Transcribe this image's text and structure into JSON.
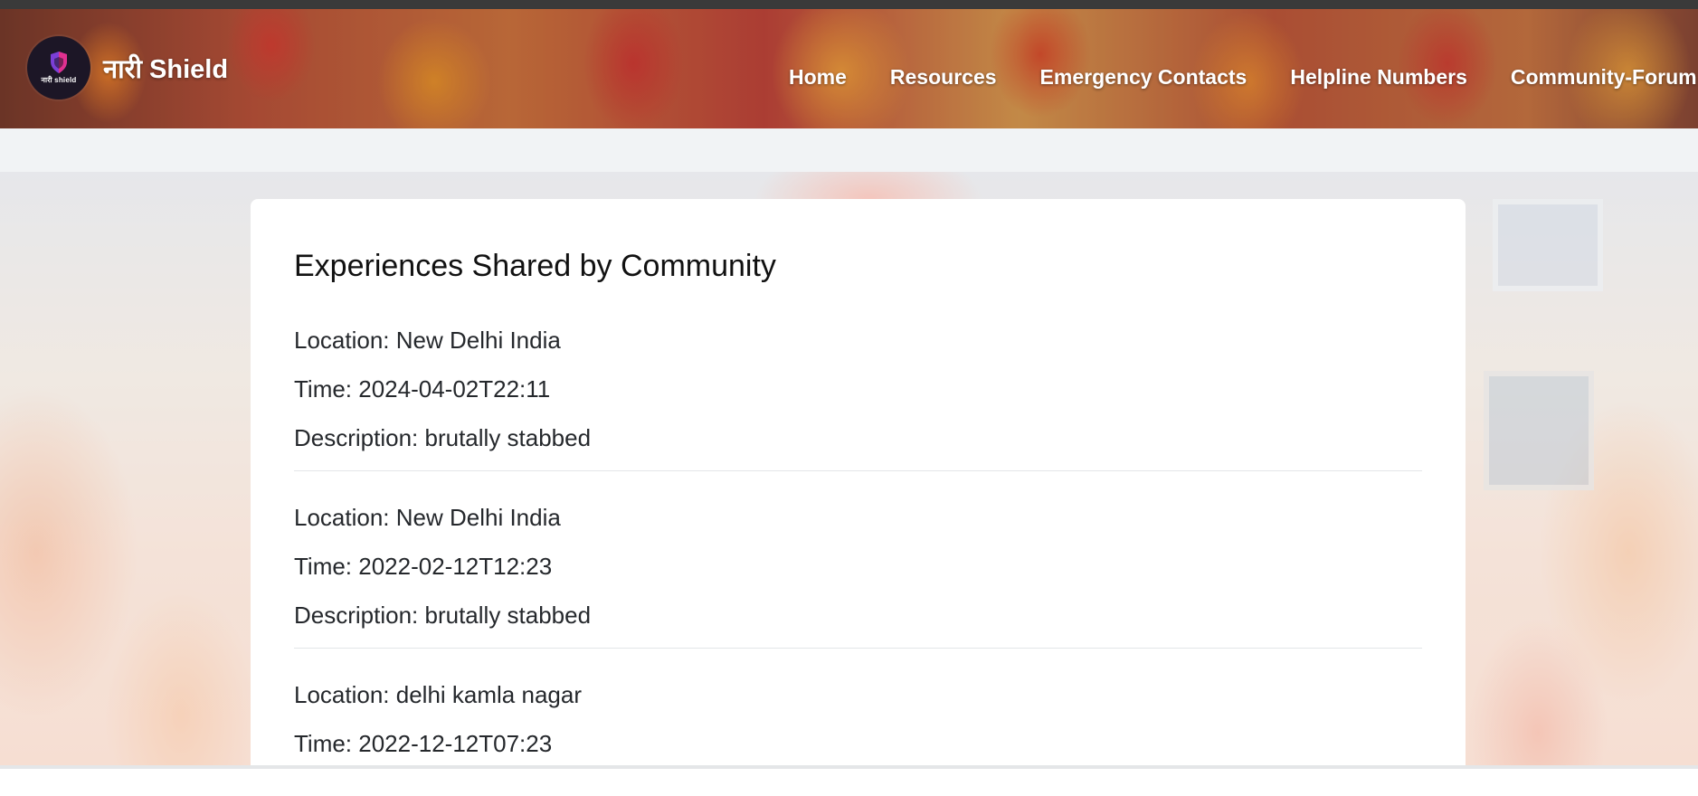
{
  "brand": {
    "name": "नारी Shield",
    "logo_text": "नारी shield",
    "logo_icon": "shield-icon"
  },
  "nav": {
    "links": [
      {
        "label": "Home"
      },
      {
        "label": "Resources"
      },
      {
        "label": "Emergency Contacts"
      },
      {
        "label": "Helpline Numbers"
      },
      {
        "label": "Community-Forum"
      }
    ]
  },
  "main": {
    "title": "Experiences Shared by Community",
    "entries": [
      {
        "location": "Location: New Delhi India",
        "time": "Time: 2024-04-02T22:11",
        "description": "Description: brutally stabbed"
      },
      {
        "location": "Location: New Delhi India",
        "time": "Time: 2022-02-12T12:23",
        "description": "Description: brutally stabbed"
      },
      {
        "location": "Location: delhi kamla nagar",
        "time": "Time: 2022-12-12T07:23",
        "description": ""
      }
    ]
  },
  "colors": {
    "header_text": "#ffffff",
    "card_background": "#ffffff",
    "body_text": "#25282c",
    "divider": "#e3e5e8"
  }
}
